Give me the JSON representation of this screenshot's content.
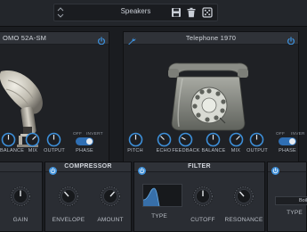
{
  "topbar": {
    "preset_name": "Speakers",
    "icons": [
      "updown-arrows-icon",
      "save-icon",
      "trash-icon",
      "random-dice-icon"
    ]
  },
  "mic_panel": {
    "title": "OMO 52A-SM",
    "knobs": [
      "BALANCE",
      "MIX",
      "OUTPUT"
    ],
    "phase": {
      "label": "PHASE",
      "off": "OFF",
      "invert": "INVERT",
      "state": "invert"
    }
  },
  "phone_panel": {
    "title": "Telephone 1970",
    "knobs": [
      "PITCH",
      "ECHO",
      "FEEDBACK",
      "BALANCE",
      "MIX",
      "OUTPUT"
    ],
    "phase": {
      "label": "PHASE",
      "off": "OFF",
      "invert": "INVER",
      "state": "invert"
    }
  },
  "gain_panel": {
    "label": "GAIN"
  },
  "compressor": {
    "title": "COMPRESSOR",
    "knobs": [
      "ENVELOPE",
      "AMOUNT"
    ]
  },
  "filter": {
    "title": "FILTER",
    "type_label": "TYPE",
    "knobs": [
      "CUTOFF",
      "RESONANCE"
    ]
  },
  "boiler_panel": {
    "value": "Boiler",
    "type_label": "TYPE"
  },
  "colors": {
    "accent": "#3d8fd9",
    "panel": "#2a2d33",
    "background": "#1a1c20"
  }
}
